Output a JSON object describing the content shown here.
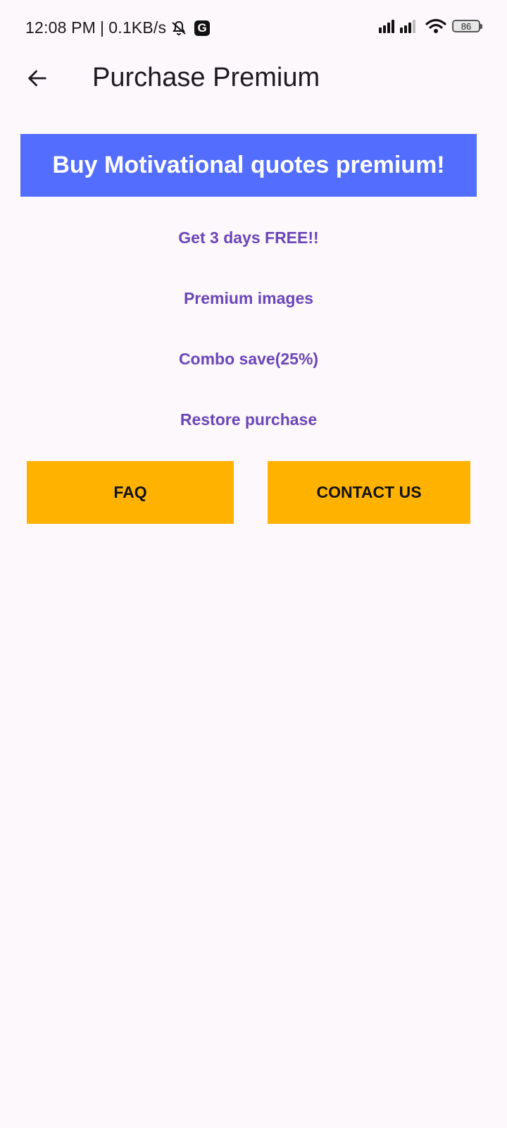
{
  "status_bar": {
    "time": "12:08 PM",
    "separator": "|",
    "net_speed": "0.1KB/s",
    "g_badge": "G",
    "battery": "86",
    "icons": [
      "bell-off-icon",
      "g-app-icon",
      "signal-icon",
      "signal-icon",
      "wifi-icon",
      "battery-icon"
    ]
  },
  "app_bar": {
    "title": "Purchase Premium",
    "back_icon": "arrow-back-icon"
  },
  "banner": {
    "text": "Buy Motivational quotes premium!",
    "color": "#536dfe"
  },
  "features": [
    {
      "label": "Get 3 days FREE!!"
    },
    {
      "label": "Premium images"
    },
    {
      "label": "Combo save(25%)"
    },
    {
      "label": "Restore purchase"
    }
  ],
  "buttons": {
    "faq": "FAQ",
    "contact": "CONTACT US",
    "color": "#ffb300"
  },
  "colors": {
    "accent_text": "#6b46b8",
    "background": "#fdf8fc"
  }
}
